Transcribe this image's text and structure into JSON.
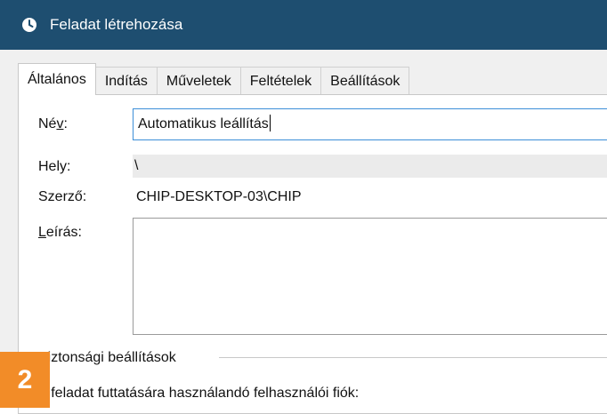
{
  "window": {
    "title": "Feladat létrehozása",
    "icon": "clock-icon"
  },
  "tabs": [
    {
      "label": "Általános",
      "active": true
    },
    {
      "label": "Indítás",
      "active": false
    },
    {
      "label": "Műveletek",
      "active": false
    },
    {
      "label": "Feltételek",
      "active": false
    },
    {
      "label": "Beállítások",
      "active": false
    }
  ],
  "general": {
    "name_label_prefix": "Né",
    "name_label_hotkey": "v",
    "name_label_suffix": ":",
    "name_value": "Automatikus leállítás",
    "location_label": "Hely:",
    "location_value": "\\",
    "author_label": "Szerző:",
    "author_value": "CHIP-DESKTOP-03\\CHIP",
    "description_label_hotkey": "L",
    "description_label_rest": "eírás:",
    "description_value": "",
    "security_group_title": "Biztonsági beállítások",
    "security_account_text": "A feladat futtatására használandó felhasználói fiók:"
  },
  "badge": {
    "number": "2",
    "color": "#f28c28"
  },
  "colors": {
    "titlebar": "#1e4e70",
    "input_focus_border": "#3c8fd8"
  }
}
